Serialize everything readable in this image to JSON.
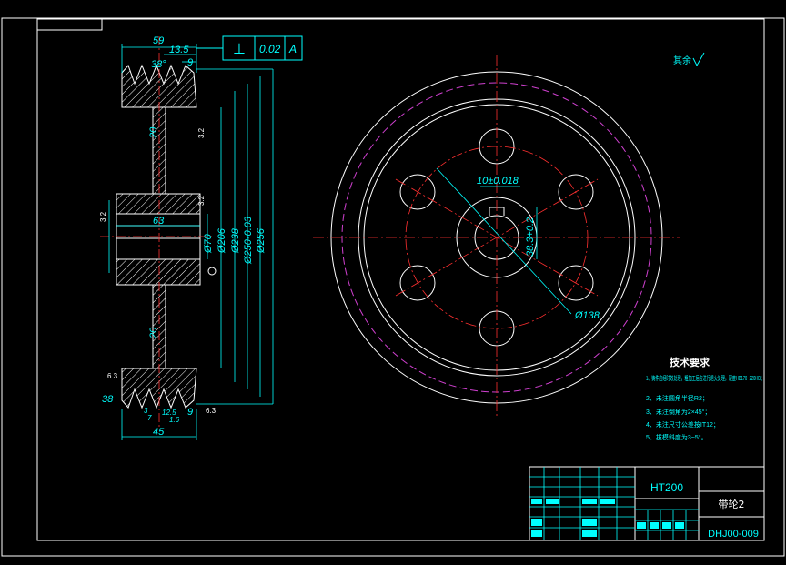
{
  "colors": {
    "background": "#000000",
    "frame": "#ffffff",
    "dimension": "#00ffff",
    "centerline": "#ff3030",
    "pitch_circle": "#d040d0",
    "section": "#ffffff"
  },
  "gdt": {
    "symbol": "⊥",
    "tolerance": "0.02",
    "datum": "A"
  },
  "roughness_note": "其余",
  "section_dims": {
    "width_top": "59",
    "offset_13_5": "13.5",
    "groove_pitch_top": "9",
    "groove_angle": "38°",
    "web_top": "20",
    "web_bottom": "20",
    "hub_length": "63",
    "d70": "Ø70",
    "d206": "Ø206",
    "d238": "Ø238",
    "d250": "Ø250-0.03",
    "d256": "Ø256",
    "width_bottom": "45",
    "groove_pitch_bottom": "9",
    "angle_bottom": "38",
    "small_dims": [
      "12.5",
      "3",
      "7",
      "1.6"
    ],
    "roughness_marks": [
      "3.2",
      "3.2",
      "3.2",
      "6.3",
      "6.3"
    ]
  },
  "front_view_dims": {
    "keyway": "10±0.018",
    "keyway_depth": "38.3+0.2",
    "bolt_circle": "Ø138"
  },
  "tech_requirements": {
    "heading": "技术要求",
    "items": [
      "1、铸件应经时效处理，粗加工后应进行退火处理，硬度HB170~220HB；",
      "2、未注圆角半径R2；",
      "3、未注倒角为2×45°；",
      "4、未注尺寸公差按IT12；",
      "5、拔模斜度为3~5°。"
    ]
  },
  "title_block": {
    "material": "HT200",
    "part_name": "带轮2",
    "drawing_number": "DHJ00-009"
  }
}
